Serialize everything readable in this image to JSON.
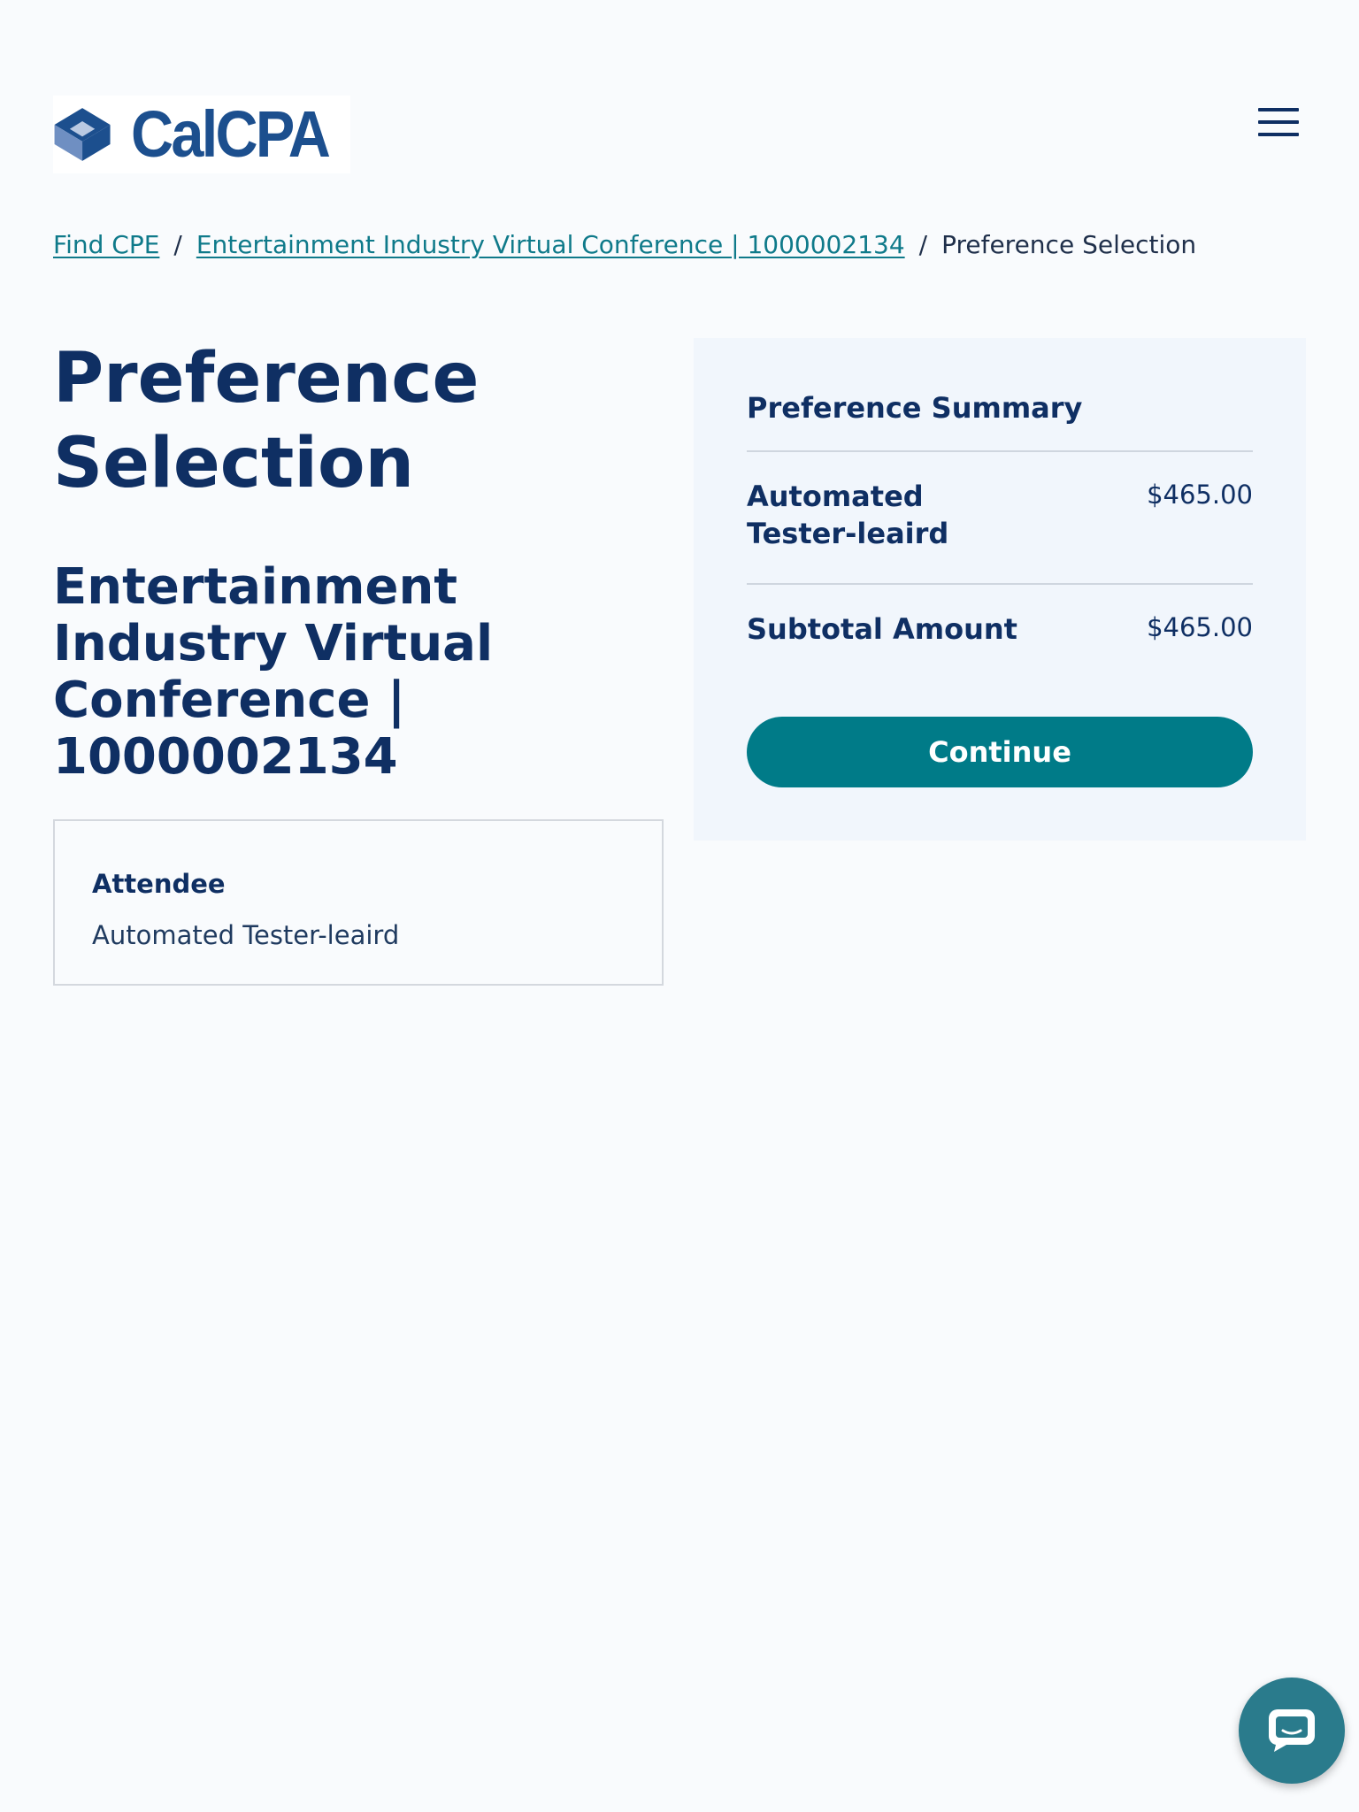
{
  "brand": {
    "name": "CalCPA",
    "logo_icon": "calcpa-cube-icon",
    "colors": {
      "primary": "#0f2f63",
      "logo": "#1c4f8e",
      "accent": "#007b88",
      "link": "#0f7a8a"
    }
  },
  "header": {
    "menu_icon": "hamburger-menu-icon"
  },
  "breadcrumb": {
    "items": [
      {
        "label": "Find CPE"
      },
      {
        "label": "Entertainment Industry Virtual Conference | 1000002134"
      },
      {
        "label": "Preference Selection"
      }
    ],
    "separator": "/"
  },
  "main": {
    "page_title": "Preference Selection",
    "event_title": "Entertainment Industry Virtual Conference | 1000002134",
    "attendee": {
      "label": "Attendee",
      "name": "Automated Tester-leaird"
    }
  },
  "summary": {
    "heading": "Preference Summary",
    "line_item": {
      "name": "Automated Tester-leaird",
      "price": "$465.00"
    },
    "subtotal": {
      "label": "Subtotal Amount",
      "price": "$465.00"
    },
    "continue_label": "Continue"
  },
  "chat": {
    "icon": "chat-bubble-icon"
  }
}
